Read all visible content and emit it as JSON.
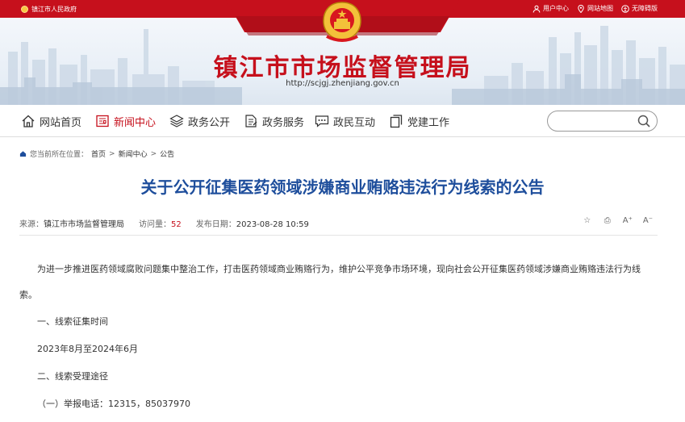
{
  "topbar": {
    "gov_label": "镇江市人民政府",
    "links": [
      {
        "label": "用户中心",
        "icon": "user-icon"
      },
      {
        "label": "网站地图",
        "icon": "map-pin-icon"
      },
      {
        "label": "无障碍版",
        "icon": "accessibility-icon"
      }
    ]
  },
  "header": {
    "site_title": "镇江市市场监督管理局",
    "site_url": "http://scjgj.zhenjiang.gov.cn"
  },
  "nav": {
    "items": [
      {
        "label": "网站首页",
        "icon": "home-icon"
      },
      {
        "label": "新闻中心",
        "icon": "news-icon"
      },
      {
        "label": "政务公开",
        "icon": "layers-icon"
      },
      {
        "label": "政务服务",
        "icon": "document-icon"
      },
      {
        "label": "政民互动",
        "icon": "chat-icon"
      },
      {
        "label": "党建工作",
        "icon": "copy-icon"
      }
    ],
    "active_index": 1,
    "search_placeholder": ""
  },
  "breadcrumb": {
    "prefix": "您当前所在位置：",
    "items": [
      "首页",
      "新闻中心",
      "公告"
    ],
    "sep": ">"
  },
  "article": {
    "title": "关于公开征集医药领域涉嫌商业贿赂违法行为线索的公告",
    "source_label": "来源：",
    "source_value": "镇江市市场监督管理局",
    "views_label": "访问量：",
    "views_value": "52",
    "date_label": "发布日期：",
    "date_value": "2023-08-28 10:59",
    "tools": [
      "☆",
      "⎙",
      "A⁺",
      "A⁻"
    ],
    "paragraphs": [
      "为进一步推进医药领域腐败问题集中整治工作，打击医药领域商业贿赂行为，维护公平竞争市场环境，现向社会公开征集医药领域涉嫌商业贿赂违法行为线索。",
      "一、线索征集时间",
      "2023年8月至2024年6月",
      "二、线索受理途径",
      "（一）举报电话：12315，85037970"
    ]
  },
  "colors": {
    "brand_red": "#c6101c",
    "title_blue": "#1e4e9c"
  }
}
